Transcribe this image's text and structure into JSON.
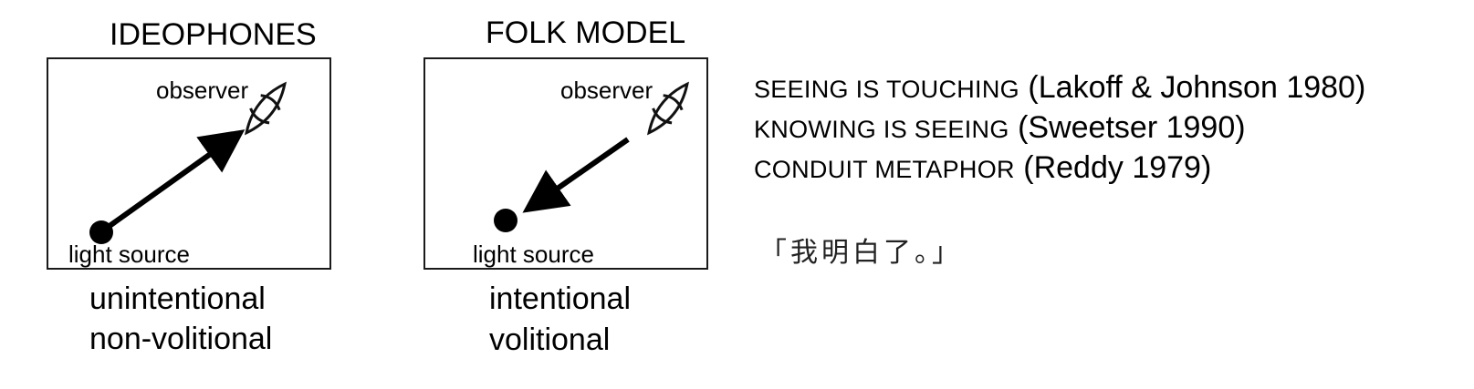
{
  "left_panel": {
    "title": "IDEOPHONES",
    "observer_label": "observer",
    "source_label": "light source",
    "arrow_direction": "source-to-observer",
    "captions": [
      "unintentional",
      "non-volitional"
    ]
  },
  "right_panel": {
    "title": "FOLK MODEL",
    "observer_label": "observer",
    "source_label": "light source",
    "arrow_direction": "observer-to-source",
    "captions": [
      "intentional",
      "volitional"
    ]
  },
  "metaphors": [
    {
      "name": "SEEING IS TOUCHING",
      "citation": "(Lakoff & Johnson 1980)"
    },
    {
      "name": "KNOWING IS SEEING",
      "citation": "(Sweetser 1990)"
    },
    {
      "name": "CONDUIT METAPHOR",
      "citation": "(Reddy 1979)"
    }
  ],
  "example_sentence": "「我明白了。」",
  "icons": [
    "eye-icon",
    "light-source-dot",
    "arrow"
  ],
  "colors": {
    "ink": "#000000",
    "frame": "#1a1a1a",
    "background": "#ffffff"
  }
}
